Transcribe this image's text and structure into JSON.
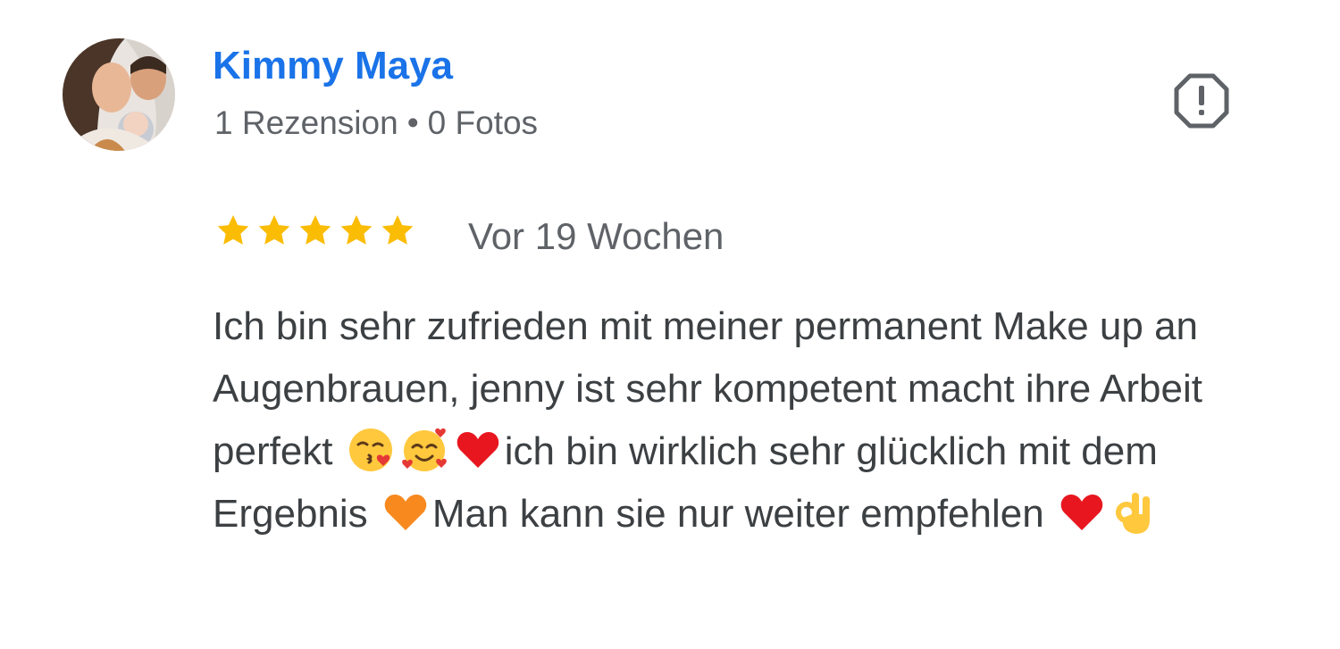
{
  "reviewer": {
    "name": "Kimmy Maya",
    "review_count": "1 Rezension",
    "separator": "•",
    "photo_count": "0 Fotos",
    "avatar": "family-photo-avatar"
  },
  "actions": {
    "report_icon": "report-octagon-icon"
  },
  "review": {
    "rating": 5,
    "max_rating": 5,
    "star_color": "#fbbc04",
    "time": "Vor 19 Wochen",
    "text_parts": {
      "p1": "Ich bin sehr zufrieden mit meiner permanent Make up an Augenbrauen, jenny ist sehr kompetent macht ihre Arbeit perfekt ",
      "p2": "ich bin wirklich sehr glücklich mit dem Ergebnis ",
      "p3": "Man kann sie nur weiter empfehlen "
    },
    "emojis": [
      "face-blowing-kiss-emoji",
      "smiling-face-with-hearts-emoji",
      "red-heart-emoji",
      "orange-heart-emoji",
      "red-heart-emoji",
      "ok-hand-emoji"
    ]
  },
  "colors": {
    "name_link": "#1a73e8",
    "meta_text": "#5f6368",
    "body_text": "#3c4043"
  }
}
